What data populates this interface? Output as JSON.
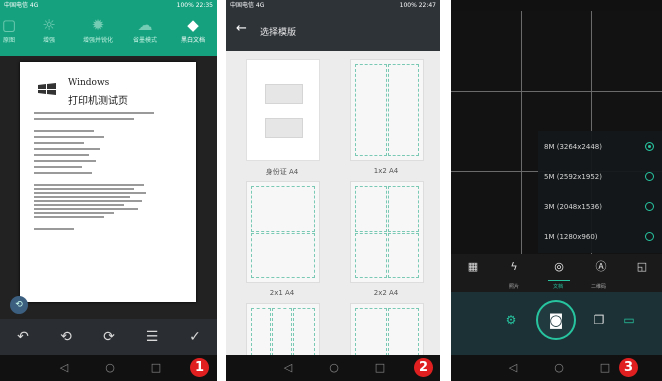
{
  "phones": [
    {
      "status_left": "中国电信 4G",
      "status_right": "100% 22:35",
      "toolbar": [
        {
          "label": "原图",
          "icon": "original-icon"
        },
        {
          "label": "增强",
          "icon": "enhance-icon"
        },
        {
          "label": "增强并锐化",
          "icon": "sharpen-icon"
        },
        {
          "label": "省墨模式",
          "icon": "ink-save-icon"
        },
        {
          "label": "黑白文档",
          "icon": "bw-document-icon"
        }
      ],
      "document": {
        "heading1": "Windows",
        "heading2": "打印机测试页"
      },
      "bottom_actions": [
        "undo-icon",
        "rotate-left-icon",
        "rotate-right-icon",
        "adjust-icon",
        "confirm-icon"
      ],
      "badge": "1"
    },
    {
      "status_left": "中国电信 4G",
      "status_right": "100% 22:47",
      "title": "选择模版",
      "templates": [
        {
          "label": "身份证 A4"
        },
        {
          "label": "1x2 A4"
        },
        {
          "label": "2x1 A4"
        },
        {
          "label": "2x2 A4"
        }
      ],
      "badge": "2"
    },
    {
      "resolution_options": [
        {
          "label": "8M (3264x2448)",
          "selected": true
        },
        {
          "label": "5M (2592x1952)",
          "selected": false
        },
        {
          "label": "3M (2048x1536)",
          "selected": false
        },
        {
          "label": "1M (1280x960)",
          "selected": false
        }
      ],
      "modes": [
        {
          "label": "照片",
          "current": false
        },
        {
          "label": "文档",
          "current": true
        },
        {
          "label": "二维码",
          "current": false
        }
      ],
      "badge": "3"
    }
  ],
  "colors": {
    "teal": "#16a17e",
    "accent": "#27c49f",
    "badge": "#e02020",
    "dark": "#2e3338"
  }
}
